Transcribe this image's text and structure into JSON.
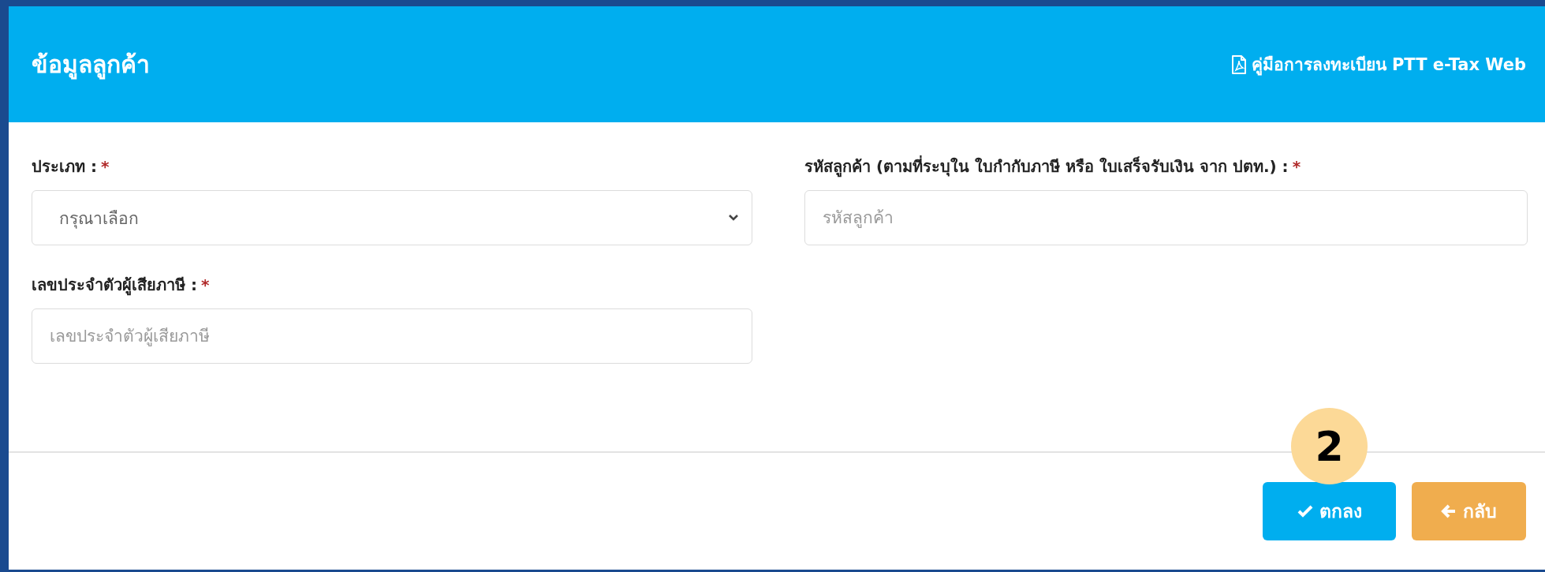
{
  "header": {
    "title": "ข้อมูลลูกค้า",
    "manual_link": "คู่มือการลงทะเบียน PTT e-Tax Web"
  },
  "fields": [
    {
      "kind": "select",
      "label": "ประเภท :",
      "required_mark": "*",
      "value": "กรุณาเลือก"
    },
    {
      "kind": "text",
      "label": "รหัสลูกค้า (ตามที่ระบุใน ใบกำกับภาษี หรือ ใบเสร็จรับเงิน จาก ปตท.) :",
      "required_mark": "*",
      "placeholder": "รหัสลูกค้า"
    },
    {
      "kind": "text",
      "label": "เลขประจำตัวผู้เสียภาษี :",
      "required_mark": "*",
      "placeholder": "เลขประจำตัวผู้เสียภาษี"
    }
  ],
  "step_badge": "2",
  "buttons": [
    {
      "kind": "confirm",
      "label": "ตกลง"
    },
    {
      "kind": "back",
      "label": "กลับ"
    }
  ]
}
